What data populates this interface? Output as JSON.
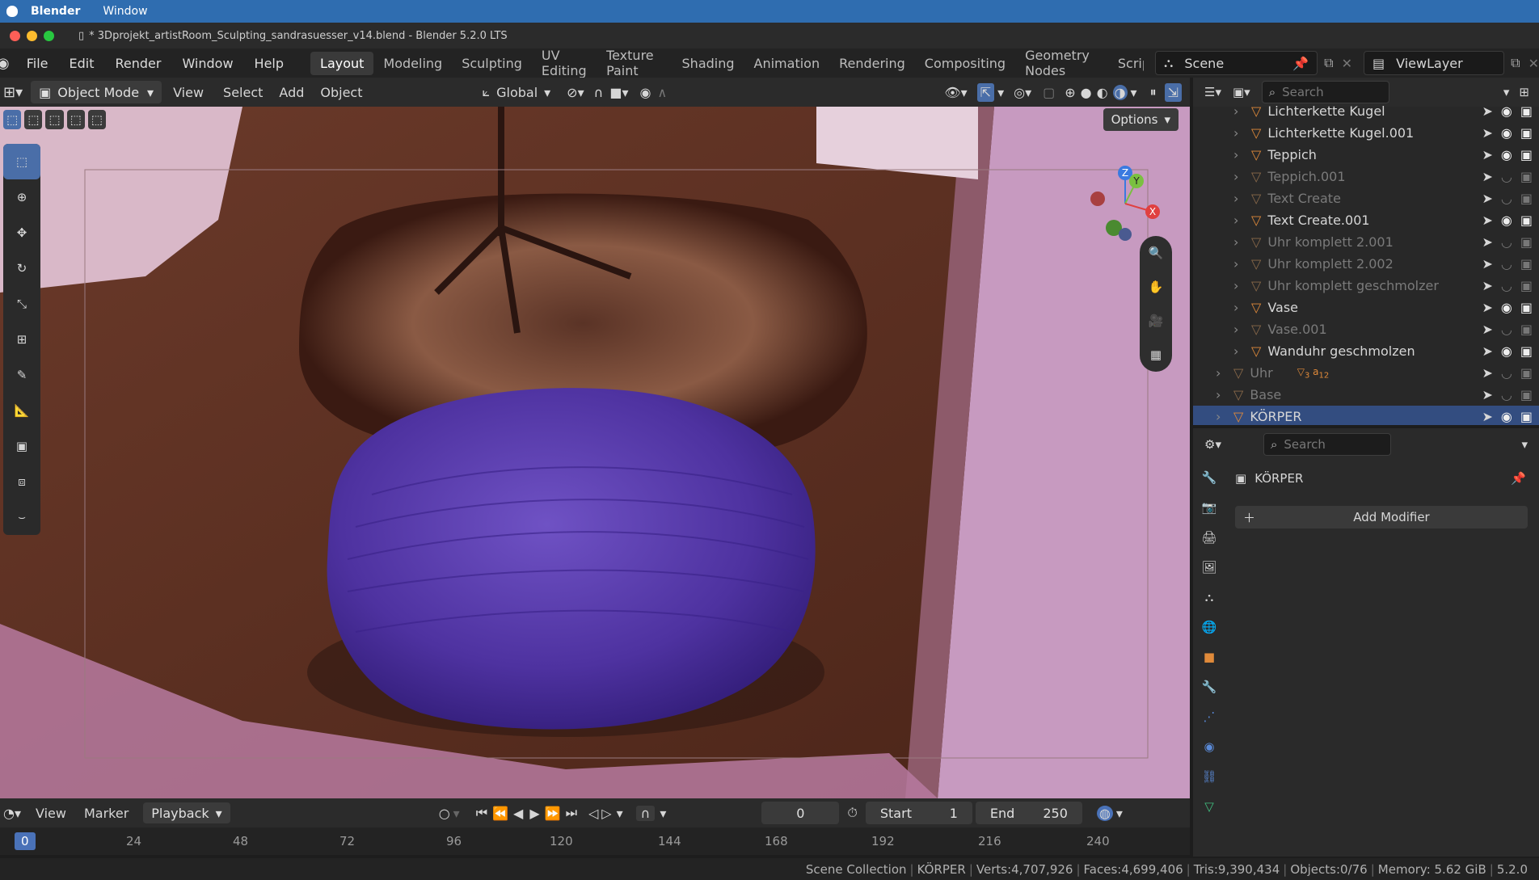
{
  "mac_menu": {
    "app": "Blender",
    "items": [
      "Window"
    ]
  },
  "title": "* 3Dprojekt_artistRoom_Sculpting_sandrasuesser_v14.blend - Blender 5.2.0 LTS",
  "menu": [
    "File",
    "Edit",
    "Render",
    "Window",
    "Help"
  ],
  "workspaces": [
    "Layout",
    "Modeling",
    "Sculpting",
    "UV Editing",
    "Texture Paint",
    "Shading",
    "Animation",
    "Rendering",
    "Compositing",
    "Geometry Nodes",
    "Scripti"
  ],
  "scene": "Scene",
  "view_layer": "ViewLayer",
  "viewport_header": {
    "mode": "Object Mode",
    "menus": [
      "View",
      "Select",
      "Add",
      "Object"
    ],
    "transform": "Global",
    "options": "Options"
  },
  "outliner": {
    "search_placeholder": "Search",
    "rows": [
      {
        "name": "Lichterkette Kugel",
        "dim": false,
        "level": 2
      },
      {
        "name": "Lichterkette Kugel.001",
        "dim": false,
        "level": 2
      },
      {
        "name": "Teppich",
        "dim": false,
        "level": 2
      },
      {
        "name": "Teppich.001",
        "dim": true,
        "level": 2
      },
      {
        "name": "Text Create",
        "dim": true,
        "level": 2
      },
      {
        "name": "Text Create.001",
        "dim": false,
        "level": 2
      },
      {
        "name": "Uhr komplett 2.001",
        "dim": true,
        "level": 2
      },
      {
        "name": "Uhr komplett 2.002",
        "dim": true,
        "level": 2
      },
      {
        "name": "Uhr komplett geschmolzer",
        "dim": true,
        "level": 2
      },
      {
        "name": "Vase",
        "dim": false,
        "level": 2
      },
      {
        "name": "Vase.001",
        "dim": true,
        "level": 2
      },
      {
        "name": "Wanduhr geschmolzen",
        "dim": false,
        "level": 2
      },
      {
        "name": "Uhr",
        "dim": true,
        "level": 1,
        "badges": [
          "3",
          "12"
        ]
      },
      {
        "name": "Base",
        "dim": true,
        "level": 1
      },
      {
        "name": "KÖRPER",
        "dim": false,
        "level": 1,
        "selected": true
      }
    ]
  },
  "properties": {
    "search_placeholder": "Search",
    "object": "KÖRPER",
    "add_modifier": "Add Modifier"
  },
  "timeline": {
    "menus": [
      "View",
      "Marker",
      "Playback"
    ],
    "current_frame": "0",
    "start_label": "Start",
    "start": "1",
    "end_label": "End",
    "end": "250",
    "frame_cursor": "0",
    "ticks": [
      "24",
      "48",
      "72",
      "96",
      "120",
      "144",
      "168",
      "192",
      "216",
      "240"
    ]
  },
  "status": [
    "Scene Collection",
    "KÖRPER",
    "Verts:4,707,926",
    "Faces:4,699,406",
    "Tris:9,390,434",
    "Objects:0/76",
    "Memory: 5.62 GiB",
    "5.2.0"
  ],
  "gizmo_axes": {
    "z": "Z",
    "y": "Y",
    "x": "X"
  },
  "colors": {
    "accent": "#4a72b8",
    "selected_row": "#334d80",
    "mac_bar": "#2f6db0",
    "pouf": "#5a3aa8"
  }
}
